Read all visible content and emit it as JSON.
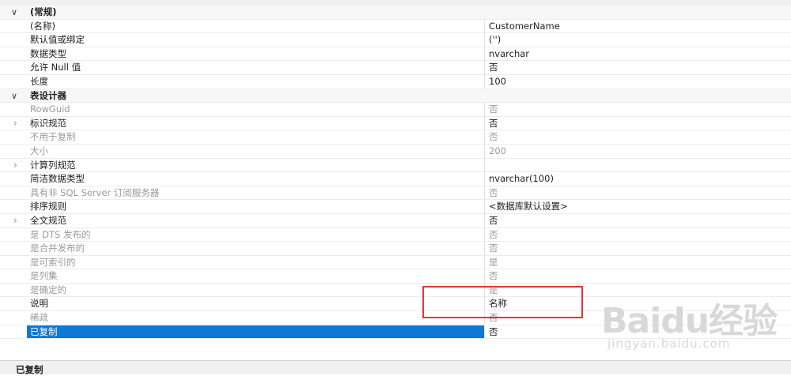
{
  "sections": [
    {
      "title": "(常规)",
      "rows": [
        {
          "name": "(名称)",
          "value": "CustomerName",
          "readonly": false
        },
        {
          "name": "默认值或绑定",
          "value": "('')",
          "readonly": false
        },
        {
          "name": "数据类型",
          "value": "nvarchar",
          "readonly": false
        },
        {
          "name": "允许 Null 值",
          "value": "否",
          "readonly": false
        },
        {
          "name": "长度",
          "value": "100",
          "readonly": false
        }
      ]
    },
    {
      "title": "表设计器",
      "rows": [
        {
          "name": "RowGuid",
          "value": "否",
          "readonly": true
        },
        {
          "name": "标识规范",
          "value": "否",
          "readonly": false,
          "expandable": true
        },
        {
          "name": "不用于复制",
          "value": "否",
          "readonly": true
        },
        {
          "name": "大小",
          "value": "200",
          "readonly": true
        },
        {
          "name": "计算列规范",
          "value": "",
          "readonly": false,
          "expandable": true
        },
        {
          "name": "简洁数据类型",
          "value": "nvarchar(100)",
          "readonly": false
        },
        {
          "name": "具有非 SQL Server 订阅服务器",
          "value": "否",
          "readonly": true
        },
        {
          "name": "排序规则",
          "value": "<数据库默认设置>",
          "readonly": false
        },
        {
          "name": "全文规范",
          "value": "否",
          "readonly": false,
          "expandable": true
        },
        {
          "name": "是 DTS 发布的",
          "value": "否",
          "readonly": true
        },
        {
          "name": "是合并发布的",
          "value": "否",
          "readonly": true
        },
        {
          "name": "是可索引的",
          "value": "是",
          "readonly": true
        },
        {
          "name": "是列集",
          "value": "否",
          "readonly": true
        },
        {
          "name": "是确定的",
          "value": "是",
          "readonly": true
        },
        {
          "name": "说明",
          "value": "名称",
          "readonly": false
        },
        {
          "name": "稀疏",
          "value": "否",
          "readonly": true
        },
        {
          "name": "已复制",
          "value": "否",
          "readonly": false,
          "selected": true
        }
      ]
    }
  ],
  "footer": {
    "label": "已复制"
  },
  "watermark": {
    "logo": "Baidu经验",
    "url": "jingyan.baidu.com"
  },
  "colors": {
    "selection": "#0f78d7",
    "highlight_box": "#e03838"
  }
}
